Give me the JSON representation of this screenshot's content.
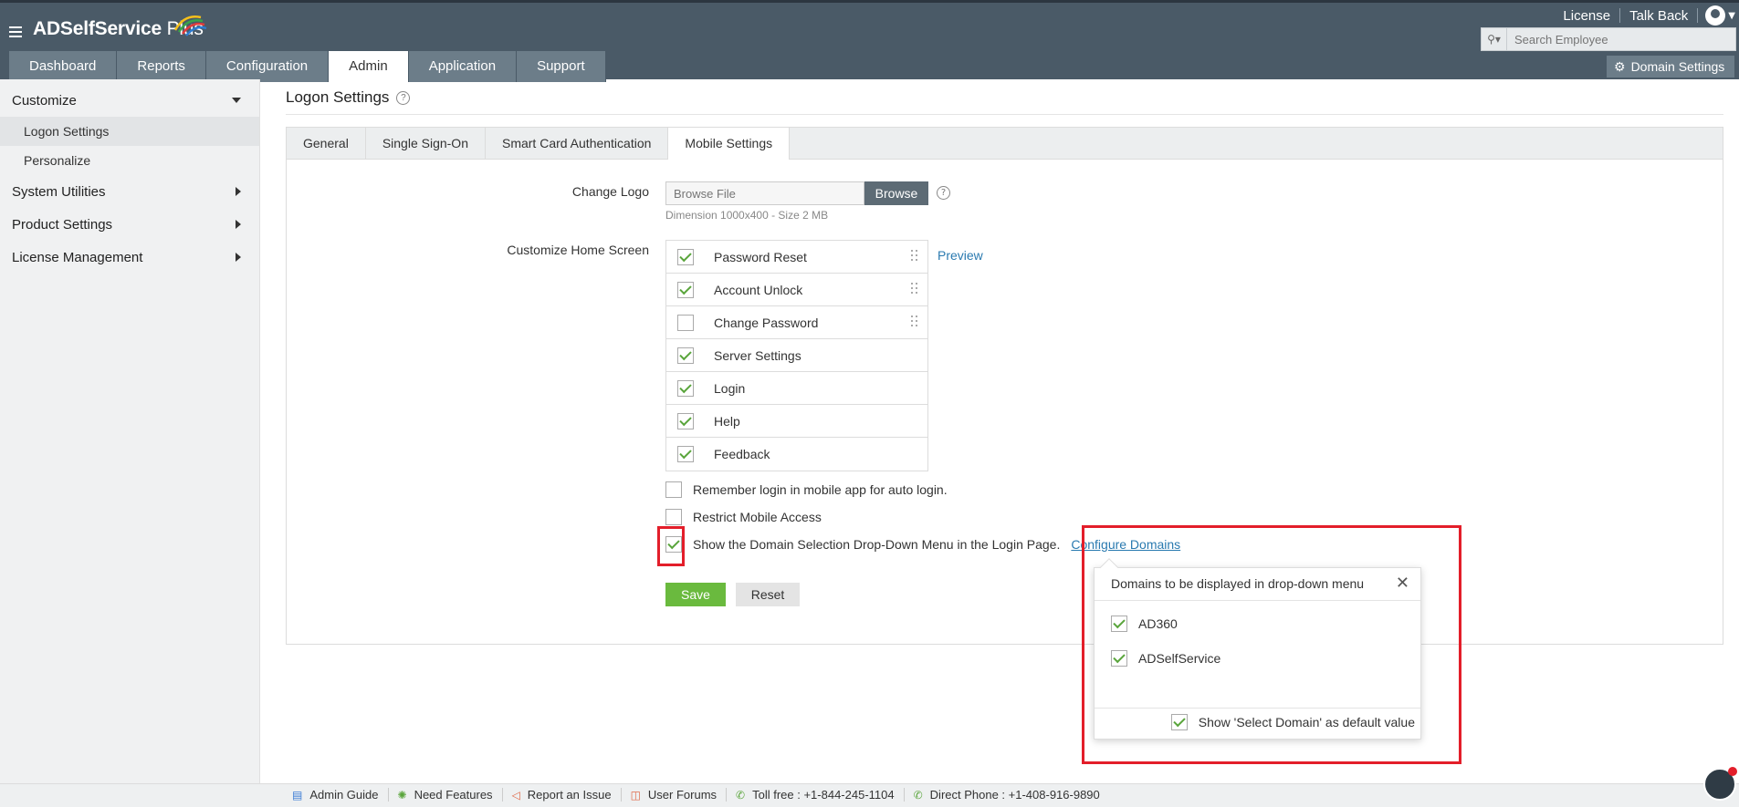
{
  "app": {
    "name_main": "ADSelfService",
    "name_suffix": "Plus"
  },
  "header": {
    "top_links": [
      "License",
      "Talk Back"
    ],
    "search_placeholder": "Search Employee",
    "nav_tabs": [
      {
        "label": "Dashboard",
        "active": false
      },
      {
        "label": "Reports",
        "active": false
      },
      {
        "label": "Configuration",
        "active": false
      },
      {
        "label": "Admin",
        "active": true
      },
      {
        "label": "Application",
        "active": false
      },
      {
        "label": "Support",
        "active": false
      }
    ],
    "domain_settings": "Domain Settings"
  },
  "sidebar": {
    "customize": "Customize",
    "customize_items": [
      "Logon Settings",
      "Personalize"
    ],
    "sections": [
      "System Utilities",
      "Product Settings",
      "License Management"
    ]
  },
  "page": {
    "title": "Logon Settings",
    "tabs": [
      {
        "label": "General",
        "active": false
      },
      {
        "label": "Single Sign-On",
        "active": false
      },
      {
        "label": "Smart Card Authentication",
        "active": false
      },
      {
        "label": "Mobile Settings",
        "active": true
      }
    ],
    "change_logo_label": "Change Logo",
    "file_placeholder": "Browse File",
    "browse_label": "Browse",
    "dimension_text": "Dimension 1000x400 - Size 2 MB",
    "home_screen_label": "Customize Home Screen",
    "preview_link": "Preview",
    "home_items": [
      {
        "label": "Password Reset",
        "checked": true,
        "draggable": true
      },
      {
        "label": "Account Unlock",
        "checked": true,
        "draggable": true
      },
      {
        "label": "Change Password",
        "checked": false,
        "draggable": true
      },
      {
        "label": "Server Settings",
        "checked": true,
        "draggable": false
      },
      {
        "label": "Login",
        "checked": true,
        "draggable": false
      },
      {
        "label": "Help",
        "checked": true,
        "draggable": false
      },
      {
        "label": "Feedback",
        "checked": true,
        "draggable": false
      }
    ],
    "remember_login": "Remember login in mobile app for auto login.",
    "remember_checked": false,
    "restrict_mobile": "Restrict Mobile Access",
    "restrict_checked": false,
    "show_domain": "Show the Domain Selection Drop-Down Menu in the Login Page.",
    "show_domain_checked": true,
    "configure_domains": "Configure Domains",
    "save_label": "Save",
    "reset_label": "Reset"
  },
  "popup": {
    "title": "Domains to be displayed in drop-down menu",
    "domains": [
      {
        "label": "AD360",
        "checked": true
      },
      {
        "label": "ADSelfService",
        "checked": true
      }
    ],
    "default_label": "Show 'Select Domain' as default value",
    "default_checked": true
  },
  "footer": {
    "items": [
      {
        "icon": "book-icon",
        "label": "Admin Guide"
      },
      {
        "icon": "bulb-icon",
        "label": "Need Features"
      },
      {
        "icon": "megaphone-icon",
        "label": "Report an Issue"
      },
      {
        "icon": "forum-icon",
        "label": "User Forums"
      },
      {
        "icon": "phone-icon",
        "label": "Toll free : +1-844-245-1104"
      },
      {
        "icon": "phone-icon",
        "label": "Direct Phone : +1-408-916-9890"
      }
    ]
  },
  "colors": {
    "header": "#4a5a67",
    "tab": "#6c7d89",
    "save": "#6aba3e",
    "link": "#2a7ab0",
    "highlight": "#e31e2a",
    "check": "#5aa53c"
  }
}
